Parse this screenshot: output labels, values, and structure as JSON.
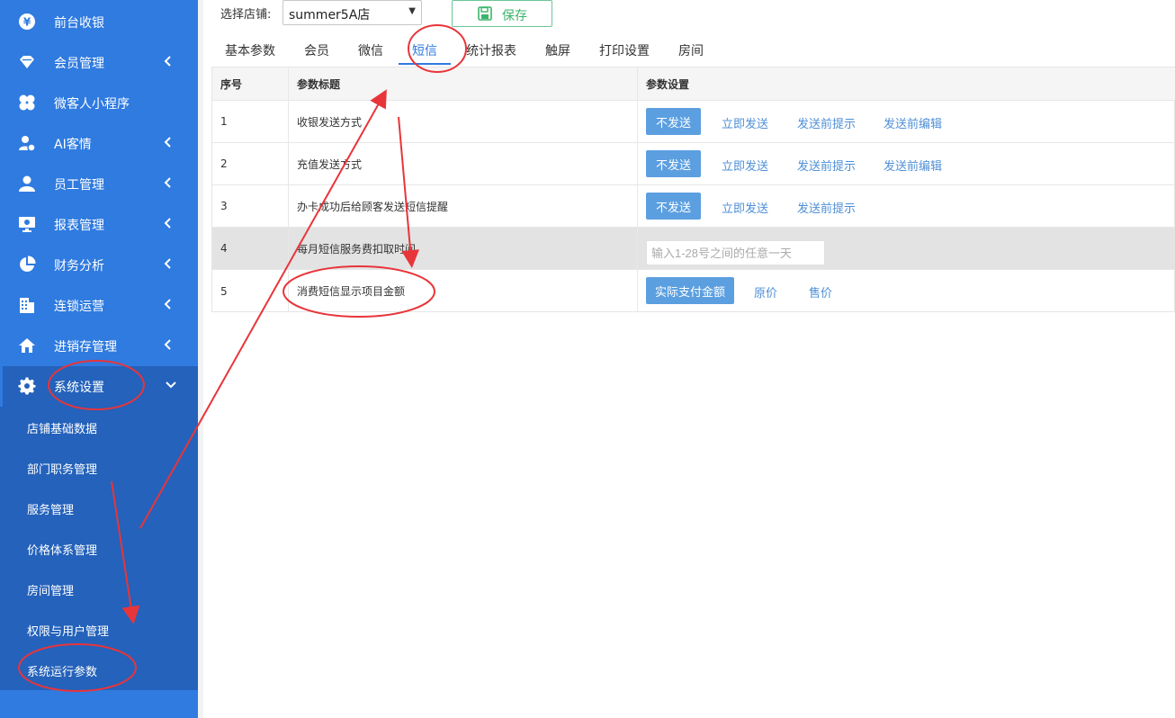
{
  "sidebar": {
    "items": [
      {
        "label": "前台收银",
        "icon": "yen-icon",
        "chevron": false
      },
      {
        "label": "会员管理",
        "icon": "diamond-icon",
        "chevron": true
      },
      {
        "label": "微客人小程序",
        "icon": "clover-icon",
        "chevron": false
      },
      {
        "label": "AI客情",
        "icon": "user-heart-icon",
        "chevron": true
      },
      {
        "label": "员工管理",
        "icon": "user-icon",
        "chevron": true
      },
      {
        "label": "报表管理",
        "icon": "monitor-chart-icon",
        "chevron": true
      },
      {
        "label": "财务分析",
        "icon": "pie-chart-icon",
        "chevron": true
      },
      {
        "label": "连锁运营",
        "icon": "building-icon",
        "chevron": true
      },
      {
        "label": "进销存管理",
        "icon": "home-icon",
        "chevron": true
      },
      {
        "label": "系统设置",
        "icon": "gear-icon",
        "chevron": true,
        "expanded": true
      }
    ],
    "submenu": [
      {
        "label": "店铺基础数据"
      },
      {
        "label": "部门职务管理"
      },
      {
        "label": "服务管理"
      },
      {
        "label": "价格体系管理"
      },
      {
        "label": "房间管理"
      },
      {
        "label": "权限与用户管理"
      },
      {
        "label": "系统运行参数"
      }
    ]
  },
  "topbar": {
    "store_label": "选择店铺:",
    "store_value": "summer5A店",
    "save_label": "保存"
  },
  "tabs": [
    {
      "label": "基本参数"
    },
    {
      "label": "会员"
    },
    {
      "label": "微信"
    },
    {
      "label": "短信",
      "active": true
    },
    {
      "label": "统计报表"
    },
    {
      "label": "触屏"
    },
    {
      "label": "打印设置"
    },
    {
      "label": "房间"
    }
  ],
  "table": {
    "headers": {
      "index": "序号",
      "title": "参数标题",
      "setting": "参数设置"
    },
    "rows": [
      {
        "index": "1",
        "title": "收银发送方式",
        "selected": "不发送",
        "options": [
          "立即发送",
          "发送前提示",
          "发送前编辑"
        ]
      },
      {
        "index": "2",
        "title": "充值发送方式",
        "selected": "不发送",
        "options": [
          "立即发送",
          "发送前提示",
          "发送前编辑"
        ]
      },
      {
        "index": "3",
        "title": "办卡成功后给顾客发送短信提醒",
        "selected": "不发送",
        "options": [
          "立即发送",
          "发送前提示"
        ]
      },
      {
        "index": "4",
        "title": "每月短信服务费扣取时间",
        "input_placeholder": "输入1-28号之间的任意一天"
      },
      {
        "index": "5",
        "title": "消费短信显示项目金额",
        "selected": "实际支付金额",
        "options": [
          "原价",
          "售价"
        ]
      }
    ]
  },
  "colors": {
    "sidebar_bg": "#2f7be0",
    "sidebar_active_bg": "#2462bb",
    "accent": "#2f7be0",
    "button_blue": "#5c9fe0",
    "save_green": "#3bb46a",
    "annotation_red": "#e8353a"
  }
}
